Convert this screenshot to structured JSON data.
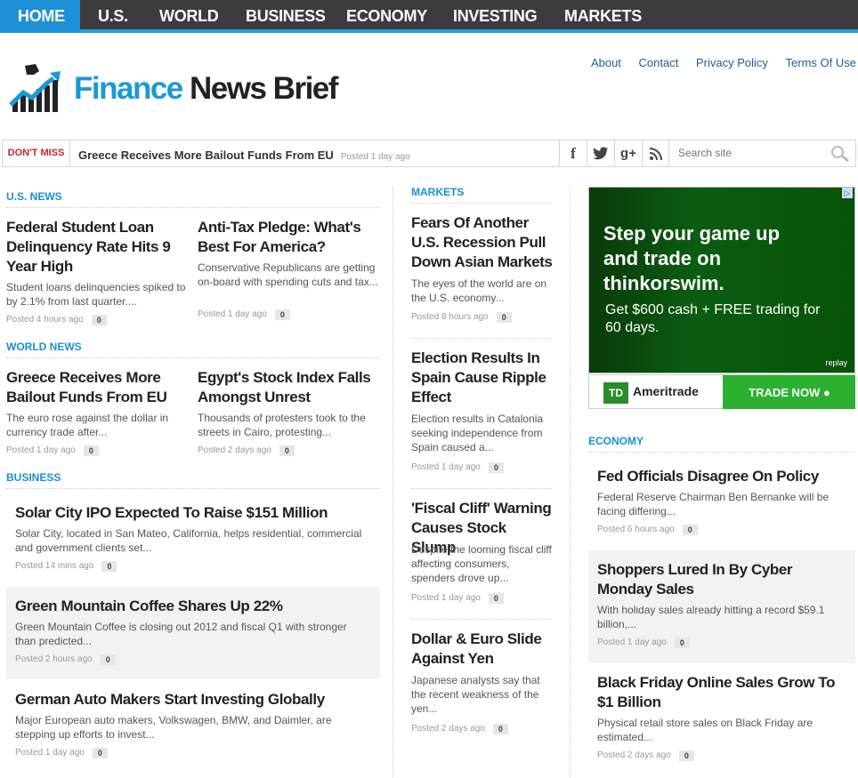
{
  "nav": [
    "HOME",
    "U.S.",
    "WORLD",
    "BUSINESS",
    "ECONOMY",
    "INVESTING",
    "MARKETS"
  ],
  "logo": {
    "finance": "Finance",
    "news": "News",
    "brief": "Brief"
  },
  "toplinks": [
    "About",
    "Contact",
    "Privacy Policy",
    "Terms Of Use"
  ],
  "dontmiss": {
    "label": "DON'T MISS",
    "title": "Greece Receives More Bailout Funds From EU",
    "posted": "Posted 1 day ago"
  },
  "search": {
    "placeholder": "Search site"
  },
  "us_news": {
    "heading": "U.S. NEWS",
    "items": [
      {
        "title": "Federal Student Loan Delinquency Rate Hits 9 Year High",
        "excerpt": "Student loans delinquencies spiked to by 2.1% from last quarter....",
        "posted": "Posted 4 hours ago",
        "count": "0"
      },
      {
        "title": "Anti-Tax Pledge: What's Best For America?",
        "excerpt": "Conservative Republicans are getting on-board with spending cuts and tax...",
        "posted": "Posted 1 day ago",
        "count": "0"
      }
    ]
  },
  "world_news": {
    "heading": "WORLD NEWS",
    "items": [
      {
        "title": "Greece Receives More Bailout Funds From EU",
        "excerpt": "The euro rose against the dollar in currency trade after...",
        "posted": "Posted 1 day ago",
        "count": "0"
      },
      {
        "title": "Egypt's Stock Index Falls Amongst Unrest",
        "excerpt": "Thousands of protesters took to the streets in Cairo, protesting...",
        "posted": "Posted 2 days ago",
        "count": "0"
      }
    ]
  },
  "business": {
    "heading": "BUSINESS",
    "items": [
      {
        "title": "Solar City IPO Expected To Raise $151 Million",
        "excerpt": "Solar City, located in San Mateo, California, helps residential, commercial and government clients set...",
        "posted": "Posted 14 mins ago",
        "count": "0"
      },
      {
        "title": "Green Mountain Coffee Shares Up 22%",
        "excerpt": "Green Mountain Coffee is closing out 2012 and fiscal Q1 with stronger than predicted...",
        "posted": "Posted 2 hours ago",
        "count": "0"
      },
      {
        "title": "German Auto Makers Start Investing Globally",
        "excerpt": "Major European auto makers, Volkswagen, BMW, and Daimler, are stepping up efforts to invest...",
        "posted": "Posted 1 day ago",
        "count": "0"
      }
    ]
  },
  "markets": {
    "heading": "MARKETS",
    "items": [
      {
        "title": "Fears Of Another U.S. Recession Pull Down Asian Markets",
        "excerpt": "The eyes of the world are on the U.S. economy...",
        "posted": "Posted 8 hours ago",
        "count": "0"
      },
      {
        "title": "Election Results In Spain Cause Ripple Effect",
        "excerpt": "Election results in Catalonia seeking independence from Spain caused a...",
        "posted": "Posted 1 day ago",
        "count": "0"
      },
      {
        "title": "'Fiscal Cliff' Warning Causes Stock Slump",
        "excerpt": "Despite the looming fiscal cliff affecting consumers, spenders drove up...",
        "posted": "Posted 1 day ago",
        "count": "0"
      },
      {
        "title": "Dollar & Euro Slide Against Yen",
        "excerpt": "Japanese analysts say that the recent weakness of the yen...",
        "posted": "Posted 2 days ago",
        "count": "0"
      }
    ]
  },
  "ad": {
    "headline": "Step your game up and trade on thinkorswim.",
    "sub": "Get $600 cash + FREE trading for 60 days.",
    "replay": "replay",
    "brand": "Ameritrade",
    "td": "TD",
    "cta": "TRADE NOW"
  },
  "economy": {
    "heading": "ECONOMY",
    "items": [
      {
        "title": "Fed Officials Disagree On Policy",
        "excerpt": "Federal Reserve Chairman Ben Bernanke will be facing differing...",
        "posted": "Posted 6 hours ago",
        "count": "0"
      },
      {
        "title": "Shoppers Lured In By Cyber Monday Sales",
        "excerpt": "With holiday sales already hitting a record $59.1 billion,...",
        "posted": "Posted 1 day ago",
        "count": "0"
      },
      {
        "title": "Black Friday Online Sales Grow To $1 Billion",
        "excerpt": "Physical retail store sales on Black Friday are estimated...",
        "posted": "Posted 2 days ago",
        "count": "0"
      }
    ]
  }
}
